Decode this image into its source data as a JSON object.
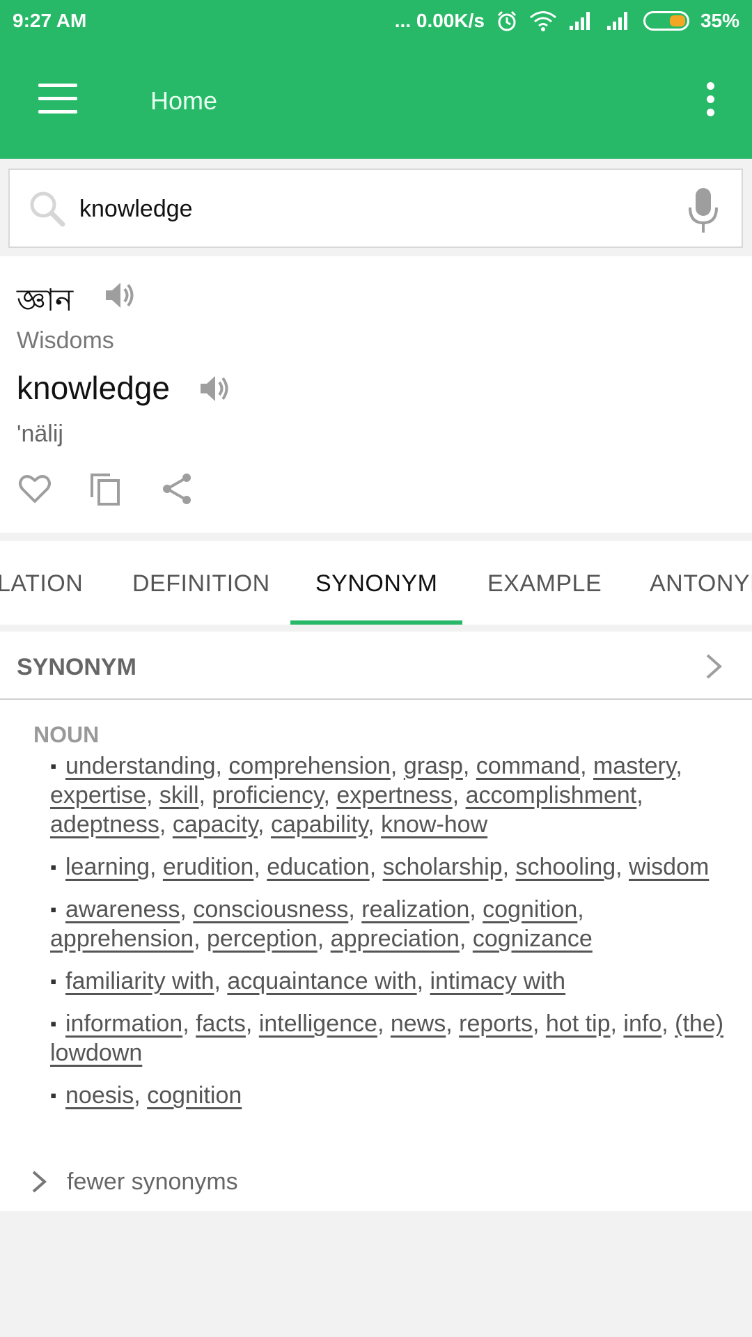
{
  "status_bar": {
    "time": "9:27 AM",
    "network_speed": "... 0.00K/s",
    "battery_percent": "35%",
    "icons": [
      "alarm-icon",
      "wifi-icon",
      "signal-icon",
      "signal-icon",
      "battery-icon"
    ]
  },
  "app_bar": {
    "title": "Home",
    "menu_icon": "hamburger-menu-icon",
    "overflow_icon": "more-vert-icon"
  },
  "search": {
    "value": "knowledge",
    "placeholder": ""
  },
  "entry": {
    "translation": "জ্ঞান",
    "translation_gloss": "Wisdoms",
    "word": "knowledge",
    "pronunciation": "'nälij",
    "actions": [
      "favorite-icon",
      "copy-icon",
      "share-icon"
    ]
  },
  "tabs": [
    {
      "label": "LATION"
    },
    {
      "label": "DEFINITION"
    },
    {
      "label": "SYNONYM",
      "active": true
    },
    {
      "label": "EXAMPLE"
    },
    {
      "label": "ANTONYM"
    }
  ],
  "synonym_section": {
    "title": "SYNONYM",
    "part_of_speech": "NOUN",
    "groups": [
      [
        "understanding",
        "comprehension",
        "grasp",
        "command",
        "mastery",
        "expertise",
        "skill",
        "proficiency",
        "expertness",
        "accomplishment",
        "adeptness",
        "capacity",
        "capability",
        "know-how"
      ],
      [
        "learning",
        "erudition",
        "education",
        "scholarship",
        "schooling",
        "wisdom"
      ],
      [
        "awareness",
        "consciousness",
        "realization",
        "cognition",
        "apprehension",
        "perception",
        "appreciation",
        "cognizance"
      ],
      [
        "familiarity with",
        "acquaintance with",
        "intimacy with"
      ],
      [
        "information",
        "facts",
        "intelligence",
        "news",
        "reports",
        "hot tip",
        "info",
        "(the) lowdown"
      ],
      [
        "noesis",
        "cognition"
      ]
    ],
    "toggle_label": "fewer synonyms"
  },
  "colors": {
    "accent": "#27b967",
    "battery": "#f5a623"
  }
}
